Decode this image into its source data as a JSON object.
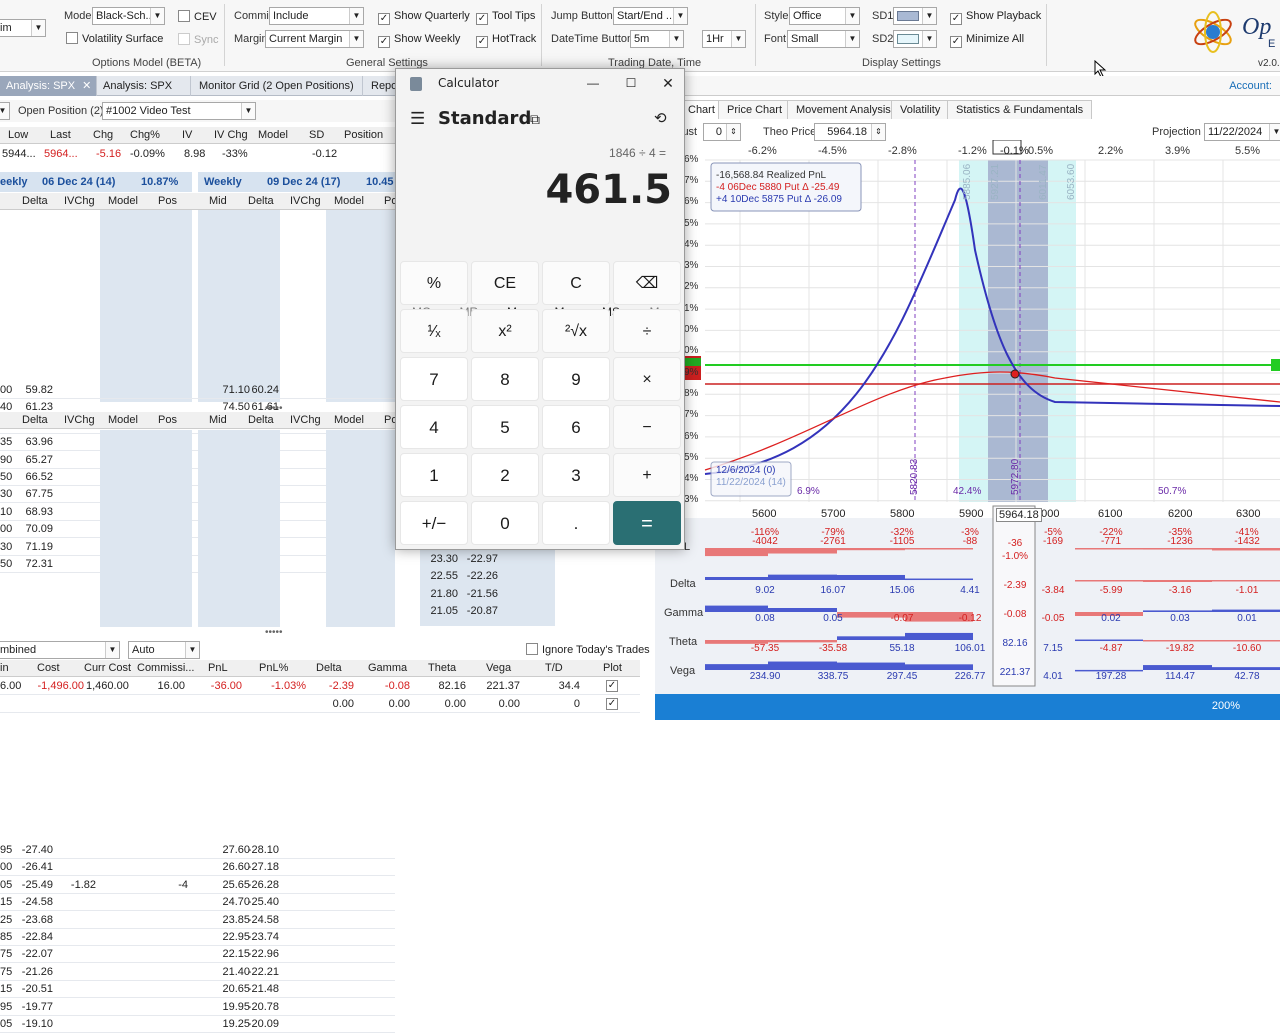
{
  "ribbon": {
    "cut_combo": "im",
    "model_label": "Model",
    "model_value": "Black-Sch...",
    "cev_label": "CEV",
    "volsurface_label": "Volatility Surface",
    "sync_label": "Sync",
    "options_model_title": "Options Model (BETA)",
    "commis_label": "Commis",
    "commis_value": "Include",
    "margin_label": "Margin",
    "margin_value": "Current Margin",
    "show_quarterly": "Show Quarterly",
    "show_weekly": "Show Weekly",
    "tool_tips": "Tool Tips",
    "hottrack": "HotTrack",
    "general_settings_title": "General Settings",
    "jump_buttons_label": "Jump Buttons",
    "jump_buttons_value": "Start/End ...",
    "datetime_buttons_label": "DateTime Buttons",
    "datetime_buttons_value": "5m",
    "datetime_buttons_value2": "1Hr",
    "trading_date_title": "Trading Date, Time",
    "style_label": "Style",
    "style_value": "Office",
    "font_label": "Font",
    "font_value": "Small",
    "sd1_label": "SD1",
    "sd2_label": "SD2",
    "show_playback": "Show Playback",
    "minimize_all": "Minimize All",
    "display_settings_title": "Display Settings",
    "logo_text": "Op",
    "logo_sub": "E",
    "version": "v2.0."
  },
  "tabs": [
    {
      "label": "Analysis: SPX",
      "active": true
    },
    {
      "label": "Analysis: SPX",
      "active": false
    },
    {
      "label": "Monitor Grid (2 Open Positions)",
      "active": false
    },
    {
      "label": "Repo",
      "active": false
    }
  ],
  "account_label": "Account:",
  "position_bar": {
    "label": "Open Position (2)",
    "combo": "#1002 Video Test"
  },
  "quote": {
    "headers": [
      "Low",
      "Last",
      "Chg",
      "Chg%",
      "IV",
      "IV Chg",
      "Model",
      "SD",
      "Position"
    ],
    "values": [
      "5944...",
      "5964...",
      "-5.16",
      "-0.09%",
      "8.98",
      "-33%",
      "",
      "-0.12",
      ""
    ]
  },
  "chain1": {
    "left_title": "eekly",
    "left_date": "06 Dec 24 (14)",
    "left_iv": "10.87%",
    "right_title": "Weekly",
    "right_date": "09 Dec 24 (17)",
    "right_iv": "10.45",
    "left_headers": [
      "Delta",
      "IVChg",
      "Model",
      "Pos"
    ],
    "right_headers": [
      "Mid",
      "Delta",
      "IVChg",
      "Model",
      "Po"
    ],
    "rows": [
      {
        "a": "00",
        "delta": "59.82",
        "mid": "71.10",
        "d2": "60.24"
      },
      {
        "a": "40",
        "delta": "61.23",
        "mid": "74.50",
        "d2": "61.61"
      },
      {
        "a": "80",
        "delta": "62.62",
        "mid": "77.95",
        "d2": "62.94"
      },
      {
        "a": "35",
        "delta": "63.96",
        "mid": "81.45",
        "d2": "64.24"
      },
      {
        "a": "90",
        "delta": "65.27",
        "mid": "85.00",
        "d2": "65.51"
      },
      {
        "a": "50",
        "delta": "66.52",
        "mid": "88.65",
        "d2": "66.74"
      },
      {
        "a": "30",
        "delta": "67.75",
        "mid": "92.30",
        "d2": "67.95"
      },
      {
        "a": "10",
        "delta": "68.93",
        "mid": "96.10",
        "d2": "69.09"
      },
      {
        "a": "00",
        "delta": "70.09",
        "mid": "99.90",
        "d2": "70.22"
      },
      {
        "a": "30",
        "delta": "71.19",
        "mid": "103.70",
        "d2": "71.32"
      },
      {
        "a": "50",
        "delta": "72.31",
        "mid": "107.60",
        "d2": "72.38"
      }
    ]
  },
  "chain2": {
    "left_headers": [
      "Delta",
      "IVChg",
      "Model",
      "Pos"
    ],
    "right_headers": [
      "Mid",
      "Delta",
      "IVChg",
      "Model",
      "Po"
    ],
    "rows": [
      {
        "a": "95",
        "delta": "-27.40",
        "ivchg": "",
        "pos": "",
        "mid": "27.60",
        "d2": "-28.10"
      },
      {
        "a": "00",
        "delta": "-26.41",
        "ivchg": "",
        "pos": "",
        "mid": "26.60",
        "d2": "-27.18"
      },
      {
        "a": "05",
        "delta": "-25.49",
        "ivchg": "-1.82",
        "pos": "-4",
        "mid": "25.65",
        "d2": "-26.28"
      },
      {
        "a": "15",
        "delta": "-24.58",
        "ivchg": "",
        "pos": "",
        "mid": "24.70",
        "d2": "-25.40"
      },
      {
        "a": "25",
        "delta": "-23.68",
        "ivchg": "",
        "pos": "",
        "mid": "23.85",
        "d2": "-24.58"
      },
      {
        "a": "85",
        "delta": "-22.84",
        "ivchg": "",
        "pos": "",
        "mid": "22.95",
        "d2": "-23.74"
      },
      {
        "a": "75",
        "delta": "-22.07",
        "ivchg": "",
        "pos": "",
        "mid": "22.15",
        "d2": "-22.96"
      },
      {
        "a": "75",
        "delta": "-21.26",
        "ivchg": "",
        "pos": "",
        "mid": "21.40",
        "d2": "-22.21"
      },
      {
        "a": "15",
        "delta": "-20.51",
        "ivchg": "",
        "pos": "",
        "mid": "20.65",
        "d2": "-21.48",
        "mid3": "22.55",
        "d3": "-22.26"
      },
      {
        "a": "95",
        "delta": "-19.77",
        "ivchg": "",
        "pos": "",
        "mid": "19.95",
        "d2": "-20.78",
        "mid3": "21.80",
        "d3": "-21.56"
      },
      {
        "a": "05",
        "delta": "-19.10",
        "ivchg": "",
        "pos": "",
        "mid": "19.25",
        "d2": "-20.09",
        "mid3": "21.05",
        "d3": "-20.87"
      }
    ],
    "extra_row": {
      "mid3": "23.30",
      "d3": "-22.97"
    }
  },
  "bottom": {
    "combo1": "mbined",
    "combo2": "Auto",
    "ignore_label": "Ignore Today's Trades",
    "headers": [
      "in",
      "Cost",
      "Curr Cost",
      "Commissi...",
      "PnL",
      "PnL%",
      "Delta",
      "Gamma",
      "Theta",
      "Vega",
      "T/D",
      "Plot"
    ],
    "row1": [
      "6.00",
      "-1,496.00",
      "1,460.00",
      "16.00",
      "-36.00",
      "-1.03%",
      "-2.39",
      "-0.08",
      "82.16",
      "221.37",
      "34.4",
      ""
    ],
    "row2": [
      "",
      "",
      "",
      "",
      "",
      "",
      "0.00",
      "0.00",
      "0.00",
      "0.00",
      "0",
      ""
    ]
  },
  "calculator": {
    "title": "Calculator",
    "mode": "Standard",
    "expression": "1846 ÷ 4 =",
    "result": "461.5",
    "memory": [
      "MC",
      "MR",
      "M+",
      "M−",
      "MS",
      "M⌄"
    ],
    "keys": [
      [
        "%",
        "CE",
        "C",
        "⌫"
      ],
      [
        "¹⁄ₓ",
        "x²",
        "²√x",
        "÷"
      ],
      [
        "7",
        "8",
        "9",
        "×"
      ],
      [
        "4",
        "5",
        "6",
        "−"
      ],
      [
        "1",
        "2",
        "3",
        "+"
      ],
      [
        "+/−",
        "0",
        ".",
        "="
      ]
    ]
  },
  "right_panel": {
    "tabs": [
      "Chart",
      "Price Chart",
      "Movement Analysis",
      "Volatility",
      "Statistics & Fundamentals"
    ],
    "adjust_label": "just",
    "adjust_value": "0",
    "theo_label": "Theo Price",
    "theo_value": "5964.18",
    "projection_label": "Projection",
    "projection_value": "11/22/2024",
    "pct_ticks": [
      "-6.2%",
      "-4.5%",
      "-2.8%",
      "-1.2%",
      "-0.1%",
      "0.5%",
      "2.2%",
      "3.9%",
      "5.5%"
    ],
    "y_ticks": [
      "6%",
      "7%",
      "6%",
      "5%",
      "4%",
      "3%",
      "2%",
      "1%",
      "0%",
      "0%",
      "9%",
      "8%",
      "7%",
      "6%",
      "5%",
      "4%",
      "3%",
      "2%",
      "1%"
    ],
    "legend": [
      "-16,568.84 Realized PnL",
      "-4 06Dec 5880 Put Δ  -25.49",
      "+4 10Dec 5875 Put Δ  -26.09"
    ],
    "date_legend": [
      "12/6/2024 (0)",
      "11/22/2024 (14)"
    ],
    "vlabels": [
      "5820.83",
      "5972.80",
      "5885.06",
      "5927.21",
      "6011.47",
      "6053.60"
    ],
    "pct_labels": [
      "6.9%",
      "42.4%",
      "50.7%"
    ],
    "x_ticks": [
      "5600",
      "5700",
      "5800",
      "5900",
      "5964.18",
      "6000",
      "6100",
      "6200",
      "6300"
    ],
    "greeks": {
      "labels": [
        "L",
        "Delta",
        "Gamma",
        "Theta",
        "Vega"
      ],
      "pnl_pct": [
        "-116%",
        "-79%",
        "-32%",
        "-3%",
        "",
        "-5%",
        "-22%",
        "-35%",
        "-41%"
      ],
      "pnl": [
        "-4042",
        "-2761",
        "-1105",
        "-88",
        "",
        "-169",
        "-771",
        "-1236",
        "-1432"
      ],
      "delta": [
        "9.02",
        "16.07",
        "15.06",
        "4.41",
        "",
        "-3.84",
        "-5.99",
        "-3.16",
        "-1.01"
      ],
      "gamma": [
        "0.08",
        "0.05",
        "-0.07",
        "-0.12",
        "",
        "-0.05",
        "0.02",
        "0.03",
        "0.01"
      ],
      "theta": [
        "-57.35",
        "-35.58",
        "55.18",
        "106.01",
        "",
        "7.15",
        "-4.87",
        "-19.82",
        "-10.60"
      ],
      "vega": [
        "234.90",
        "338.75",
        "297.45",
        "226.77",
        "",
        "4.01",
        "197.28",
        "114.47",
        "42.78"
      ],
      "current": {
        "pnl": "-36",
        "pnl_pct": "-1.0%",
        "delta": "-2.39",
        "gamma": "-0.08",
        "theta": "82.16",
        "vega": "221.37"
      }
    },
    "zoom": "200%"
  },
  "colors": {
    "accent": "#2a6f73",
    "status_bar": "#1a7fd4",
    "chain_blue": "#dde6f0"
  }
}
